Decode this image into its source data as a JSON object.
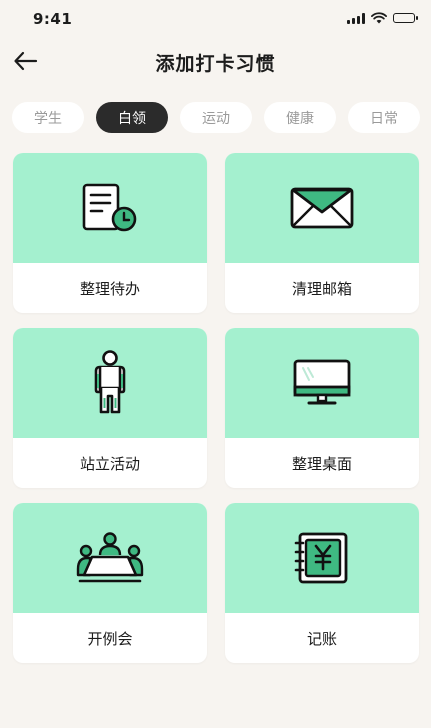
{
  "status": {
    "time": "9:41",
    "battery_level": 1.0
  },
  "header": {
    "title": "添加打卡习惯",
    "back_icon": "arrow-left-icon"
  },
  "tabs": [
    {
      "label": "学生",
      "active": false
    },
    {
      "label": "白领",
      "active": true
    },
    {
      "label": "运动",
      "active": false
    },
    {
      "label": "健康",
      "active": false
    },
    {
      "label": "日常",
      "active": false
    }
  ],
  "habits": [
    {
      "label": "整理待办",
      "icon": "todo-document-clock-icon"
    },
    {
      "label": "清理邮箱",
      "icon": "envelope-icon"
    },
    {
      "label": "站立活动",
      "icon": "standing-person-icon"
    },
    {
      "label": "整理桌面",
      "icon": "desktop-monitor-icon"
    },
    {
      "label": "开例会",
      "icon": "meeting-table-icon"
    },
    {
      "label": "记账",
      "icon": "ledger-yen-icon"
    }
  ],
  "colors": {
    "card_accent": "#a4f0cf",
    "icon_green": "#3fb982",
    "tab_active_bg": "#2b2b2b",
    "page_bg": "#f7f4f0"
  }
}
